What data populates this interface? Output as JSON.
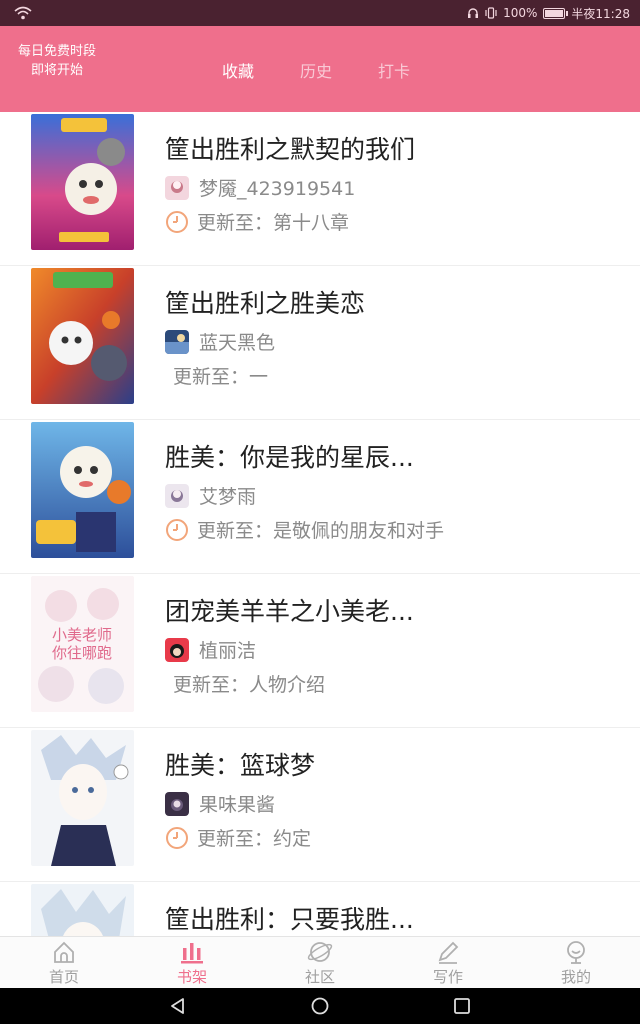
{
  "status_bar": {
    "signal_icon": "wifi-icon",
    "battery_percent": "100%",
    "battery_level": 1.0,
    "time": "半夜11:28"
  },
  "header": {
    "free_slot_line1": "每日免费时段",
    "free_slot_line2": "即将开始",
    "tabs": [
      {
        "label": "收藏",
        "active": true
      },
      {
        "label": "历史",
        "active": false
      },
      {
        "label": "打卡",
        "active": false
      }
    ],
    "background_color": "#ef6f8c"
  },
  "books": [
    {
      "title": "筐出胜利之默契的我们",
      "author": "梦魇_423919541",
      "update": "更新至：第十八章",
      "has_clock": true
    },
    {
      "title": "筐出胜利之胜美恋",
      "author": "蓝天黑色",
      "update": "更新至：一",
      "has_clock": false
    },
    {
      "title": "胜美：你是我的星辰...",
      "author": "艾梦雨",
      "update": "更新至：是敬佩的朋友和对手",
      "has_clock": true
    },
    {
      "title": "团宠美羊羊之小美老...",
      "author": "植丽洁",
      "update": "更新至：人物介绍",
      "has_clock": false,
      "cover_text_1": "小美老师",
      "cover_text_2": "你往哪跑"
    },
    {
      "title": "胜美：篮球梦",
      "author": "果味果酱",
      "update": "更新至：约定",
      "has_clock": true
    },
    {
      "title": "筐出胜利：只要我胜...",
      "author": "",
      "update": "",
      "has_clock": false
    }
  ],
  "bottom_nav": [
    {
      "label": "首页",
      "icon": "home-icon",
      "active": false
    },
    {
      "label": "书架",
      "icon": "bookshelf-icon",
      "active": true
    },
    {
      "label": "社区",
      "icon": "community-icon",
      "active": false
    },
    {
      "label": "写作",
      "icon": "pen-icon",
      "active": false
    },
    {
      "label": "我的",
      "icon": "profile-icon",
      "active": false
    }
  ],
  "system_nav": [
    "back-icon",
    "home-circle-icon",
    "recents-icon"
  ],
  "accent_color": "#ef6f8c"
}
